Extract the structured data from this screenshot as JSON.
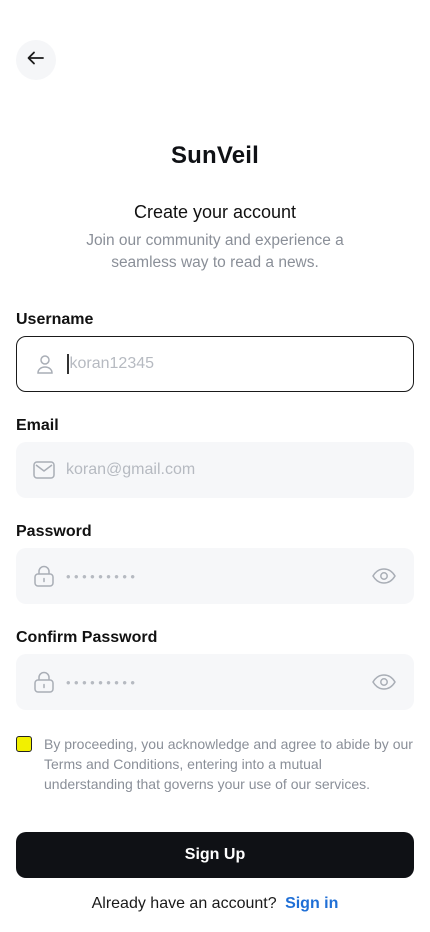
{
  "brand": "SunVeil",
  "heading": "Create your account",
  "subheading": "Join our community and experience a seamless way to read a news.",
  "fields": {
    "username": {
      "label": "Username",
      "placeholder": "koran12345"
    },
    "email": {
      "label": "Email",
      "placeholder": "koran@gmail.com"
    },
    "password": {
      "label": "Password",
      "value": "•••••••••"
    },
    "confirm_password": {
      "label": "Confirm Password",
      "value": "•••••••••"
    }
  },
  "terms": {
    "text": "By proceeding, you acknowledge and agree to abide by our Terms and Conditions, entering into a mutual understanding that governs your use of our services.",
    "checked": true
  },
  "signup_label": "Sign Up",
  "signin": {
    "prompt": "Already have an account?",
    "link": "Sign in"
  },
  "colors": {
    "primary_button": "#0f1115",
    "link": "#1f6fd6",
    "checkbox_fill": "#f2f000",
    "field_background": "#f6f7f9",
    "muted_text": "#8a8f98"
  },
  "icons": [
    "arrow-left-icon",
    "user-icon",
    "mail-icon",
    "lock-icon",
    "eye-icon"
  ]
}
